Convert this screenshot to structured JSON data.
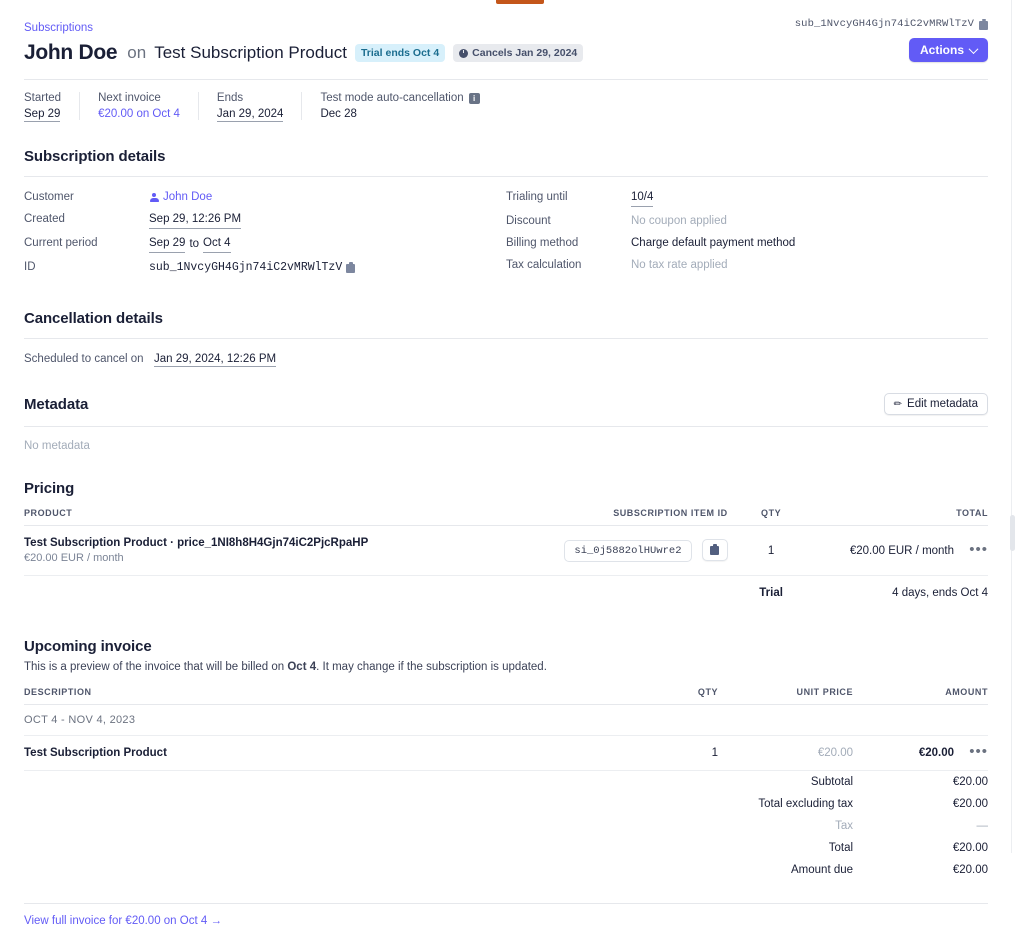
{
  "header": {
    "breadcrumb": "Subscriptions",
    "customer_name": "John Doe",
    "on_word": "on",
    "product_name": "Test Subscription Product",
    "badge_trial": "Trial ends Oct 4",
    "badge_cancel": "Cancels Jan 29, 2024",
    "subscription_id": "sub_1NvcyGH4Gjn74iC2vMRWlTzV",
    "actions_label": "Actions",
    "accent_color": "#625bf6",
    "trial_badge_bg": "#d7f0fb",
    "trial_badge_fg": "#1b6d8f",
    "cancel_badge_bg": "#e8eaee",
    "cancel_badge_fg": "#46506b",
    "test_mode_bar_color": "#c4561a"
  },
  "facts": [
    {
      "label": "Started",
      "value": "Sep 29",
      "style": "dotted"
    },
    {
      "label": "Next invoice",
      "value": "€20.00 on Oct 4",
      "style": "link"
    },
    {
      "label": "Ends",
      "value": "Jan 29, 2024",
      "style": "dotted"
    },
    {
      "label": "Test mode auto-cancellation",
      "value": "Dec 28",
      "style": "plain",
      "info": "i"
    }
  ],
  "subscription_details": {
    "title": "Subscription details",
    "left": [
      {
        "key": "Customer",
        "value": "John Doe",
        "style": "link",
        "icon": "person-icon"
      },
      {
        "key": "Created",
        "value": "Sep 29, 12:26 PM",
        "style": "dotted"
      },
      {
        "key": "Current period",
        "value": "Sep 29 to Oct 4",
        "style": "dotted-pair"
      },
      {
        "key": "ID",
        "value": "sub_1NvcyGH4Gjn74iC2vMRWlTzV",
        "style": "mono",
        "copy": true
      }
    ],
    "right": [
      {
        "key": "Trialing until",
        "value": "10/4",
        "style": "dotted"
      },
      {
        "key": "Discount",
        "value": "No coupon applied",
        "style": "muted"
      },
      {
        "key": "Billing method",
        "value": "Charge default payment method",
        "style": "plain"
      },
      {
        "key": "Tax calculation",
        "value": "No tax rate applied",
        "style": "muted"
      }
    ]
  },
  "current_period": {
    "from": "Sep 29",
    "to_word": "to",
    "to": "Oct 4"
  },
  "cancellation_details": {
    "title": "Cancellation details",
    "key": "Scheduled to cancel on",
    "value": "Jan 29, 2024, 12:26 PM"
  },
  "metadata": {
    "title": "Metadata",
    "edit_label": "Edit metadata",
    "empty": "No metadata"
  },
  "pricing": {
    "title": "Pricing",
    "columns": [
      "PRODUCT",
      "SUBSCRIPTION ITEM ID",
      "QTY",
      "TOTAL"
    ],
    "rows": [
      {
        "product": "Test Subscription Product · price_1NI8h8H4Gjn74iC2PjcRpaHP",
        "product_sub": "€20.00 EUR / month",
        "item_id": "si_0j5882olHUwre2",
        "qty": "1",
        "total": "€20.00 EUR / month",
        "menu": "•••"
      }
    ],
    "trial_row": {
      "label": "Trial",
      "value": "4 days, ends Oct 4"
    }
  },
  "upcoming_invoice": {
    "title": "Upcoming invoice",
    "description_prefix": "This is a preview of the invoice that will be billed on ",
    "description_date": "Oct 4",
    "description_suffix": ". It may change if the subscription is updated.",
    "columns": [
      "DESCRIPTION",
      "QTY",
      "UNIT PRICE",
      "AMOUNT"
    ],
    "period_label": "OCT 4 - NOV 4, 2023",
    "rows": [
      {
        "description": "Test Subscription Product",
        "qty": "1",
        "unit_price": "€20.00",
        "amount": "€20.00",
        "menu": "•••"
      }
    ],
    "totals": [
      {
        "label": "Subtotal",
        "value": "€20.00",
        "muted": false
      },
      {
        "label": "Total excluding tax",
        "value": "€20.00",
        "muted": false
      },
      {
        "label": "Tax",
        "value": "—",
        "muted": true
      },
      {
        "label": "Total",
        "value": "€20.00",
        "muted": false
      },
      {
        "label": "Amount due",
        "value": "€20.00",
        "muted": false
      }
    ],
    "footer_link": "View full invoice for €20.00 on Oct 4 →"
  }
}
